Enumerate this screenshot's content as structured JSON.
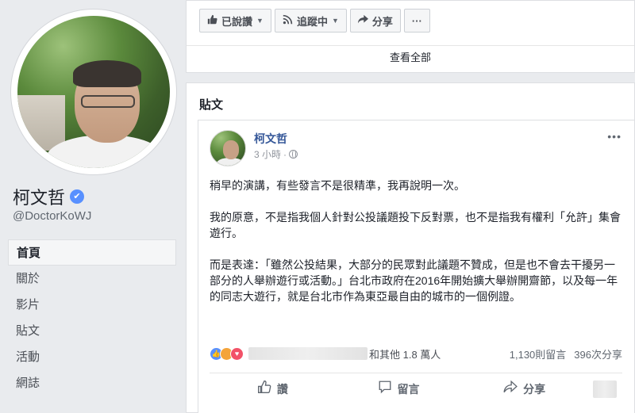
{
  "profile": {
    "name": "柯文哲",
    "verified_mark": "✔",
    "handle": "@DoctorKoWJ"
  },
  "nav": {
    "items": [
      {
        "label": "首頁",
        "active": true
      },
      {
        "label": "關於"
      },
      {
        "label": "影片"
      },
      {
        "label": "貼文"
      },
      {
        "label": "活動"
      },
      {
        "label": "網誌"
      }
    ]
  },
  "actions": {
    "liked_label": "已說讚",
    "following_label": "追蹤中",
    "share_label": "分享",
    "more_label": "···",
    "see_all": "查看全部"
  },
  "posts": {
    "section_title": "貼文",
    "post": {
      "author": "柯文哲",
      "time": "3 小時",
      "more": "•••",
      "paragraphs": [
        "稍早的演講，有些發言不是很精準，我再說明一次。",
        "我的原意，不是指我個人針對公投議題投下反對票，也不是指我有權利「允許」集會遊行。",
        "而是表達：「雖然公投結果，大部分的民眾對此議題不贊成，但是也不會去干擾另一部分的人舉辦遊行或活動。」台北市政府在2016年開始擴大舉辦開齋節，以及每一年的同志大遊行，就是台北市作為東亞最自由的城市的一個例證。"
      ],
      "reactions_text": "和其他 1.8 萬人",
      "comments": "1,130則留言",
      "shares": "396次分享",
      "like_label": "讚",
      "comment_label": "留言",
      "share_label": "分享"
    }
  },
  "icons": {
    "like": "thumbs-up-icon",
    "rss": "rss-icon",
    "share": "share-arrow-icon",
    "globe": "globe-icon",
    "comment": "comment-icon"
  },
  "colors": {
    "link": "#365899",
    "like_reaction": "#5890ff",
    "angry_reaction": "#f4a43a",
    "love_reaction": "#f25268",
    "verified": "#5890ff"
  }
}
